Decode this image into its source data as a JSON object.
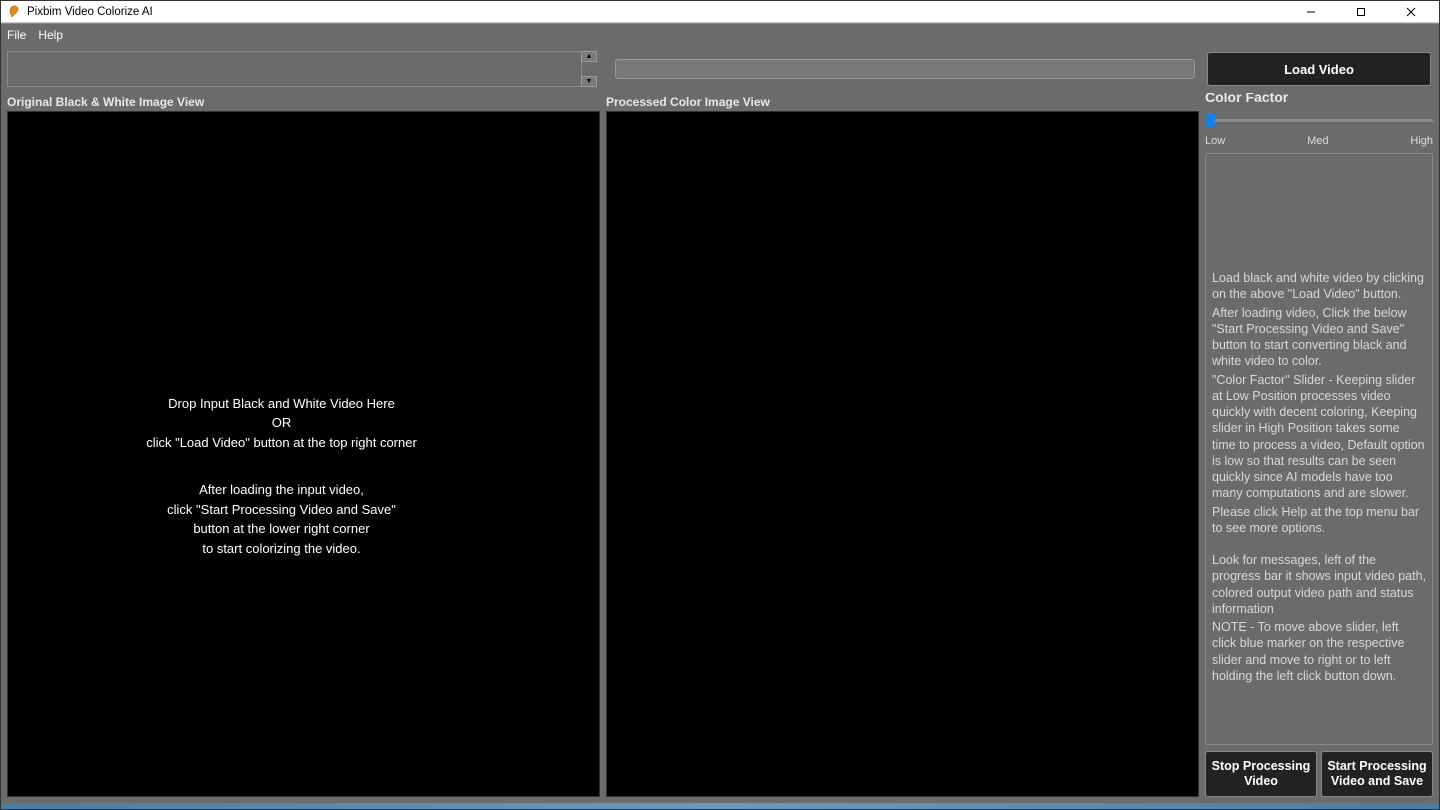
{
  "window": {
    "title": "Pixbim Video Colorize AI"
  },
  "menu": {
    "file": "File",
    "help": "Help"
  },
  "toolbar": {
    "load_video": "Load Video"
  },
  "views": {
    "original_label": "Original Black & White  Image View",
    "processed_label": "Processed Color Image View",
    "dropzone": {
      "line1": "Drop Input Black and White Video Here",
      "line2": "OR",
      "line3": "click \"Load Video\" button at the top right corner",
      "line4": "After loading the input video,",
      "line5": "click \"Start Processing Video and Save\"",
      "line6": "button at the lower right corner",
      "line7": "to start colorizing the video."
    }
  },
  "right": {
    "color_factor_label": "Color Factor",
    "slider": {
      "low": "Low",
      "med": "Med",
      "high": "High"
    },
    "info": {
      "p1": "Load black and white video by clicking on the above \"Load Video\" button.",
      "p2": "After loading video, Click the below \"Start Processing Video and Save\" button to start converting black and white video to color.",
      "p3": "\"Color Factor\" Slider - Keeping slider at Low Position processes video quickly with decent coloring, Keeping slider in High Position takes some time to process a video, Default option is low so that results can be seen quickly since AI models have too many computations and are slower.",
      "p4": "Please click Help at the top menu bar to see more options.",
      "p5": "Look for messages, left of the progress bar it shows input video path, colored output video path and status information",
      "p6": "NOTE - To move above slider, left click blue marker on the respective slider and move to right or to left holding the left click button down."
    },
    "buttons": {
      "stop": "Stop Processing\nVideo",
      "start": "Start Processing\nVideo and Save"
    }
  }
}
